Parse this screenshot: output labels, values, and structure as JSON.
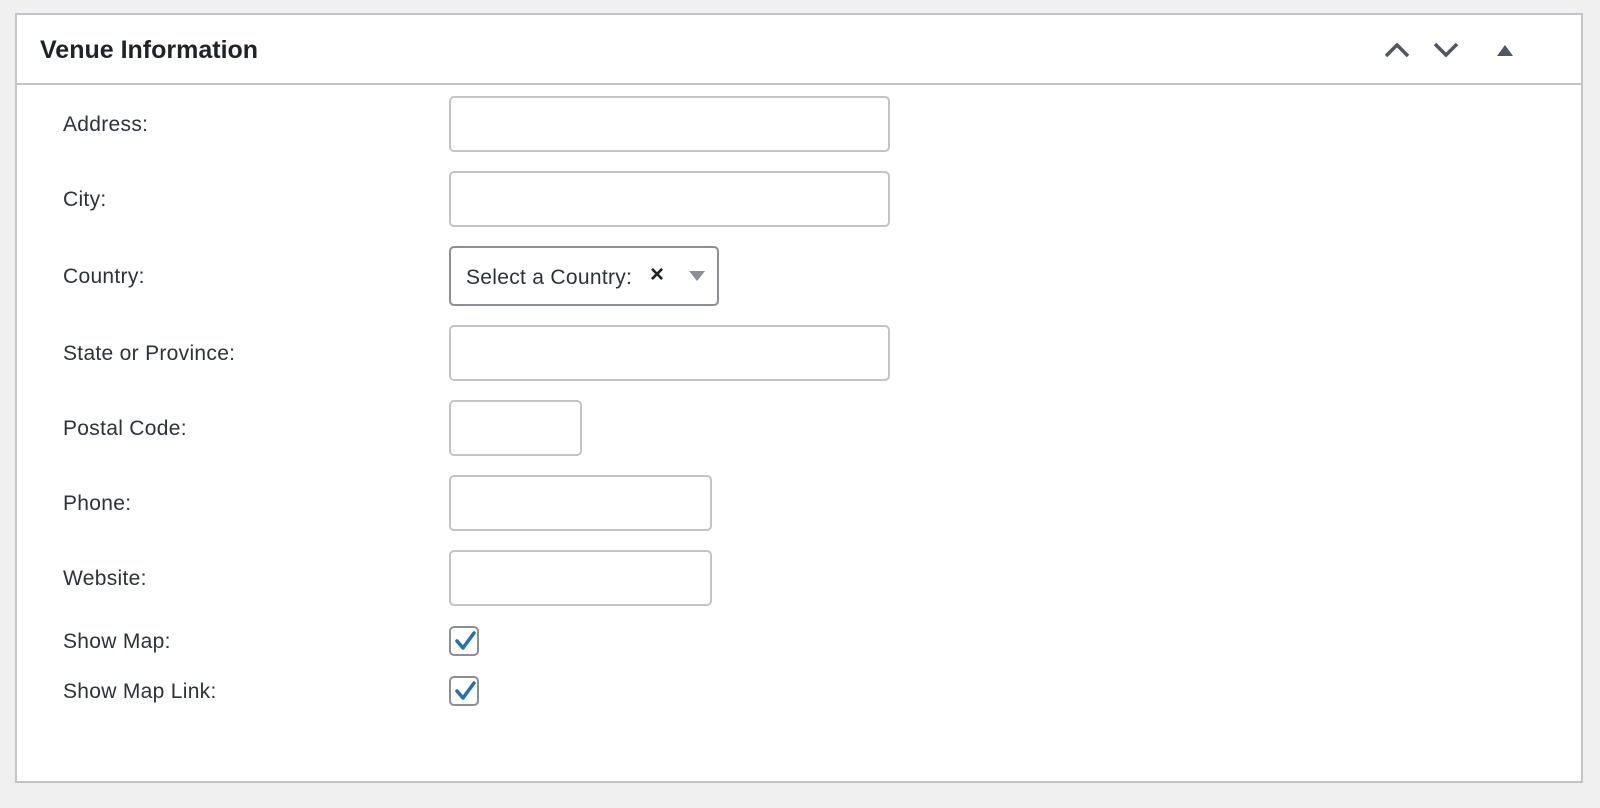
{
  "panel": {
    "title": "Venue Information",
    "controls": {
      "move_up": "chevron-up-icon",
      "move_down": "chevron-down-icon",
      "toggle": "triangle-up-icon"
    }
  },
  "fields": {
    "address": {
      "label": "Address:",
      "value": ""
    },
    "city": {
      "label": "City:",
      "value": ""
    },
    "country": {
      "label": "Country:",
      "selected": "Select a Country:",
      "clear_icon": "×"
    },
    "state": {
      "label": "State or Province:",
      "value": ""
    },
    "postal": {
      "label": "Postal Code:",
      "value": ""
    },
    "phone": {
      "label": "Phone:",
      "value": ""
    },
    "website": {
      "label": "Website:",
      "value": ""
    },
    "show_map": {
      "label": "Show Map:",
      "checked": true
    },
    "show_map_link": {
      "label": "Show Map Link:",
      "checked": true
    }
  },
  "colors": {
    "accent": "#2271b1",
    "border": "#c3c4c7",
    "background": "#f0f0f1"
  }
}
